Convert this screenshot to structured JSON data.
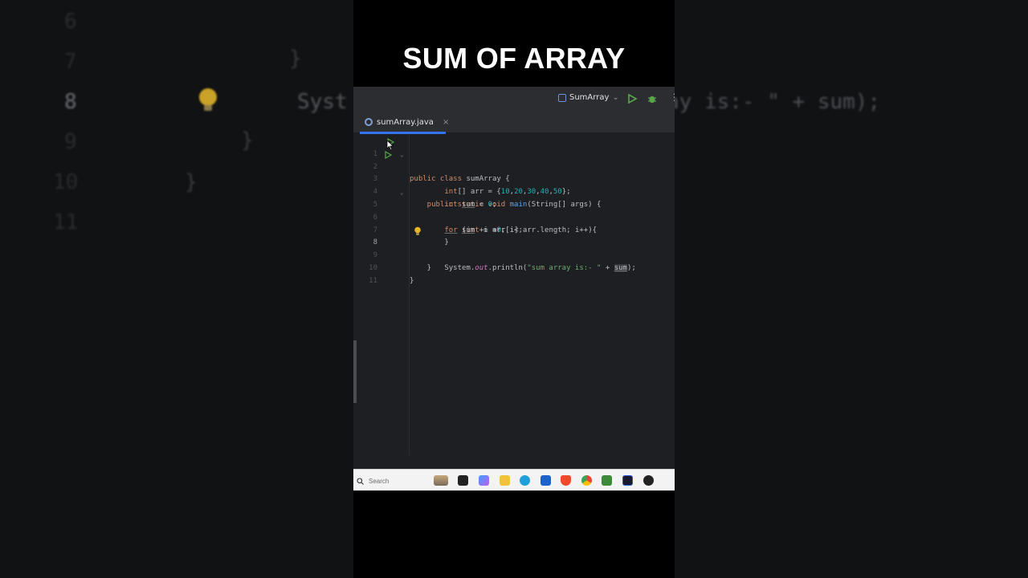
{
  "video_title": "SUM OF ARRAY",
  "background": {
    "lines": [
      {
        "num": "6",
        "text": ""
      },
      {
        "num": "7",
        "text": "    }"
      },
      {
        "num": "8",
        "text": "        Syst"
      },
      {
        "num": "9",
        "text": "  }"
      },
      {
        "num": "10",
        "text": "}"
      },
      {
        "num": "11",
        "text": ""
      }
    ],
    "right_text": "ay is:- \" + sum);"
  },
  "ide": {
    "run_config": "SumArray",
    "tab": {
      "label": "sumArray.java",
      "close": "×"
    },
    "lines": [
      {
        "num": "1",
        "html_key": "l1"
      },
      {
        "num": "2",
        "html_key": "l2"
      },
      {
        "num": "3",
        "html_key": "l3"
      },
      {
        "num": "4",
        "html_key": "l4"
      },
      {
        "num": "5",
        "html_key": "l5"
      },
      {
        "num": "6",
        "html_key": "l6"
      },
      {
        "num": "7",
        "html_key": "l7"
      },
      {
        "num": "8",
        "html_key": "l8"
      },
      {
        "num": "9",
        "html_key": "l9"
      },
      {
        "num": "10",
        "html_key": "l10"
      },
      {
        "num": "11",
        "html_key": "l11"
      }
    ],
    "code": {
      "l1_a": "public class",
      "l1_b": " sumArray {",
      "l2_a": "    public static void ",
      "l2_b": "main",
      "l2_c": "(String[] args) {",
      "l3_a": "        int",
      "l3_b": "[] arr = {",
      "l3_c": "10",
      "l3_d": ",",
      "l3_e": "20",
      "l3_f": ",",
      "l3_g": "30",
      "l3_h": ",",
      "l3_i": "40",
      "l3_j": ",",
      "l3_k": "50",
      "l3_l": "};",
      "l4_a": "        int ",
      "l4_b": "sum",
      "l4_c": " = ",
      "l4_d": "0",
      "l4_e": ";",
      "l5_a": "        ",
      "l5_b": "for",
      "l5_c": " (",
      "l5_d": "int",
      "l5_e": " i =",
      "l5_f": "0",
      "l5_g": "; i< arr.length; i++){",
      "l6_a": "            ",
      "l6_b": "sum",
      "l6_c": " += arr[i];",
      "l7_a": "        }",
      "l8_a": "        System.",
      "l8_b": "out",
      "l8_c": ".println(",
      "l8_d": "\"sum array is:- \"",
      "l8_e": " + ",
      "l8_f": "sum",
      "l8_g": ");",
      "l9_a": "    }",
      "l10_a": "}"
    }
  },
  "taskbar": {
    "search_placeholder": "Search"
  },
  "colors": {
    "editor_bg": "#1e1f22",
    "accent": "#3574f0",
    "keyword": "#cf8e6d",
    "number": "#2aacb8",
    "string": "#6aab73"
  }
}
